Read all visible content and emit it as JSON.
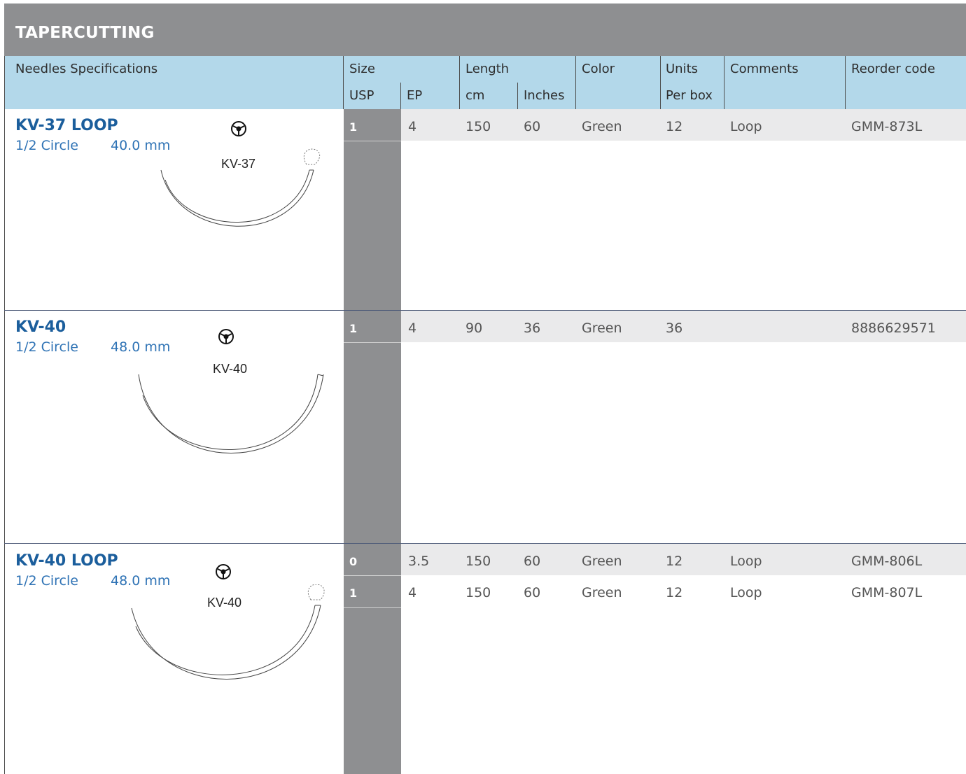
{
  "title": "TAPERCUTTING",
  "header": {
    "needles_spec": "Needles Specifications",
    "size": "Size",
    "usp": "USP",
    "ep": "EP",
    "length": "Length",
    "cm": "cm",
    "inches": "Inches",
    "color": "Color",
    "units": "Units",
    "per_box": "Per box",
    "comments": "Comments",
    "reorder": "Reorder code"
  },
  "needles": [
    {
      "name": "KV-37 LOOP",
      "shape": "1/2 Circle",
      "length": "40.0 mm",
      "code_label": "KV-37",
      "rows": [
        {
          "usp": "1",
          "ep": "4",
          "cm": "150",
          "inches": "60",
          "color": "Green",
          "units": "12",
          "comments": "Loop",
          "reorder": "GMM-873L"
        }
      ]
    },
    {
      "name": "KV-40",
      "shape": "1/2 Circle",
      "length": "48.0 mm",
      "code_label": "KV-40",
      "rows": [
        {
          "usp": "1",
          "ep": "4",
          "cm": "90",
          "inches": "36",
          "color": "Green",
          "units": "36",
          "comments": "",
          "reorder": "8886629571"
        }
      ]
    },
    {
      "name": "KV-40 LOOP",
      "shape": "1/2 Circle",
      "length": "48.0 mm",
      "code_label": "KV-40",
      "rows": [
        {
          "usp": "0",
          "ep": "3.5",
          "cm": "150",
          "inches": "60",
          "color": "Green",
          "units": "12",
          "comments": "Loop",
          "reorder": "GMM-806L"
        },
        {
          "usp": "1",
          "ep": "4",
          "cm": "150",
          "inches": "60",
          "color": "Green",
          "units": "12",
          "comments": "Loop",
          "reorder": "GMM-807L"
        }
      ]
    }
  ],
  "icons": {
    "needle_point": "tapercut-point-icon"
  },
  "colors": {
    "title_bg": "#8e8f91",
    "header_bg": "#b3d8ea",
    "name_blue": "#1b5e9c",
    "desc_blue": "#2f73b5"
  }
}
